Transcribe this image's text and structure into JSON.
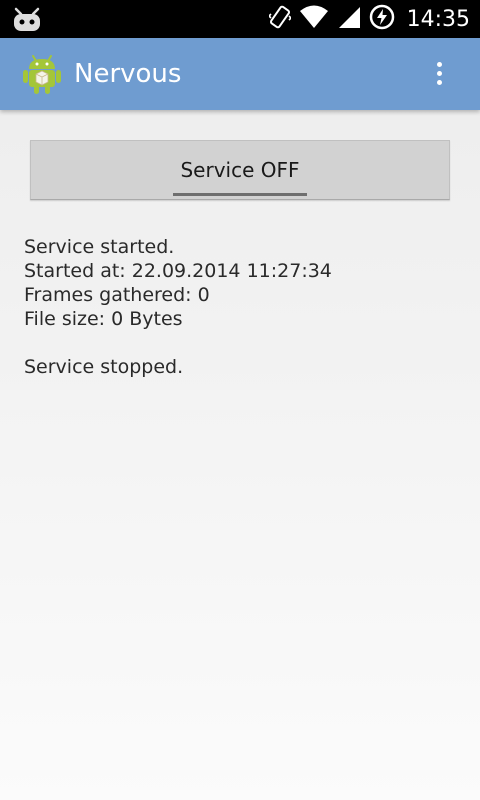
{
  "status_bar": {
    "time": "14:35",
    "icons": [
      "cyanogenmod-icon",
      "vibrate-icon",
      "wifi-icon",
      "signal-icon",
      "battery-charging-icon"
    ]
  },
  "action_bar": {
    "title": "Nervous",
    "color": "#6f9cd0",
    "icon": "android-app-icon",
    "overflow_icon": "overflow-menu-icon"
  },
  "service_toggle": {
    "label": "Service OFF"
  },
  "log": {
    "lines": [
      "Service started.",
      "Started at: 22.09.2014 11:27:34",
      "Frames gathered: 0",
      "File size: 0 Bytes"
    ],
    "final": "Service stopped."
  }
}
